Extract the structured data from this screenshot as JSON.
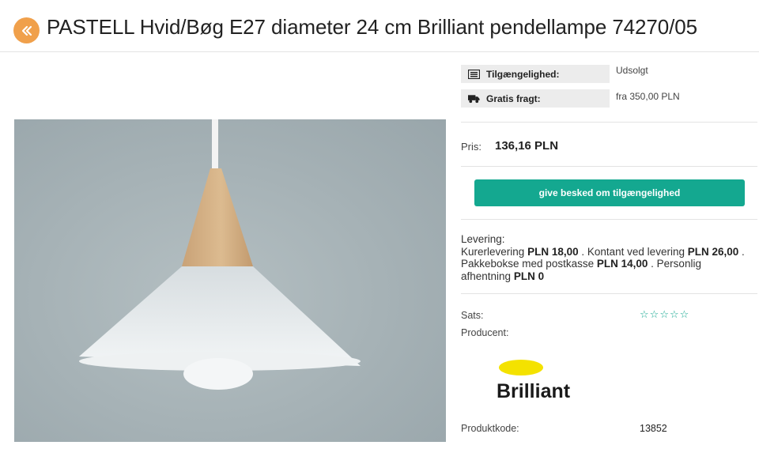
{
  "header": {
    "title": "PASTELL Hvid/Bøg E27 diameter 24 cm Brilliant pendellampe 74270/05",
    "back_icon": "chevrons-left-icon",
    "accent_color": "#f0a04b"
  },
  "availability": {
    "label": "Tilgængelighed:",
    "value": "Udsolgt",
    "icon": "list-icon"
  },
  "shipping": {
    "label": "Gratis fragt:",
    "value": "fra 350,00 PLN",
    "icon": "truck-icon"
  },
  "price": {
    "label": "Pris:",
    "value": "136,16 PLN"
  },
  "notify_button": {
    "label": "give besked om tilgængelighed",
    "color": "#14a890"
  },
  "delivery": {
    "title": "Levering:",
    "courier_label": "Kurerlevering",
    "courier_price": "PLN 18,00",
    "cod_label": ". Kontant ved levering",
    "cod_price": "PLN 26,00",
    "locker_label": ". Pakkebokse med postkasse",
    "locker_price": "PLN 14,00",
    "pickup_label": ". Personlig afhentning",
    "pickup_price": "PLN 0"
  },
  "rating": {
    "label": "Sats:",
    "stars": [
      "☆",
      "☆",
      "☆",
      "☆",
      "☆"
    ],
    "value": 0,
    "max": 5
  },
  "producer": {
    "label": "Producent:",
    "logo_text": "Brilliant",
    "logo_colors": {
      "ellipse": "#f4e200",
      "text": "#1a1a1a"
    }
  },
  "product_code": {
    "label": "Produktkode:",
    "value": "13852"
  }
}
